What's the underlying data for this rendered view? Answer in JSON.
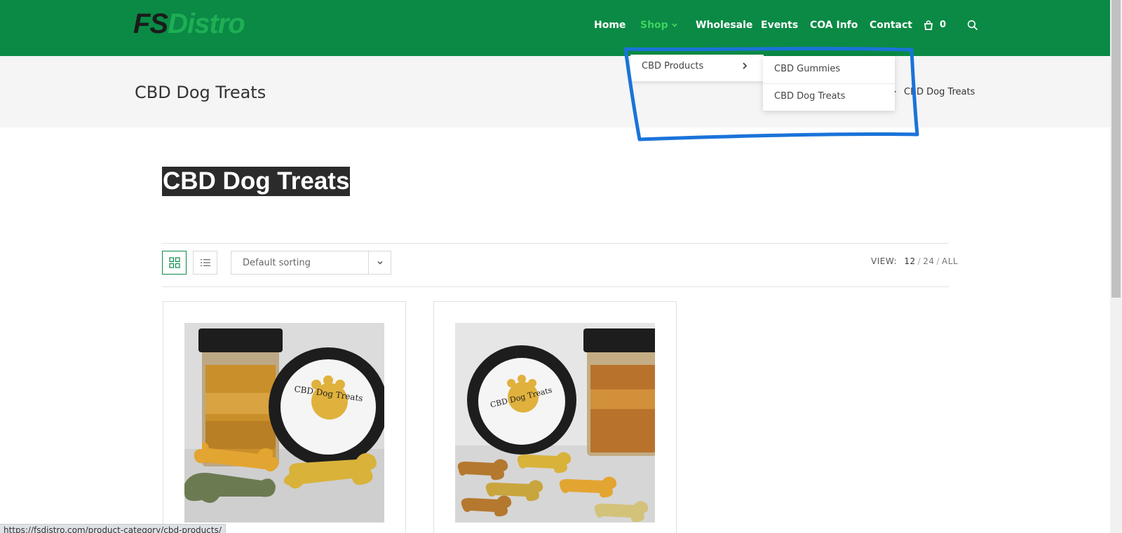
{
  "header": {
    "logo_fs": "FS",
    "logo_distro": "Distro",
    "nav": [
      "Home",
      "Shop",
      "Wholesale",
      "Events",
      "COA Info",
      "Contact"
    ],
    "active_nav": "Shop",
    "cart_count": "0",
    "colors": {
      "bar": "#0a8a45",
      "active": "#3ed35f"
    }
  },
  "dropdown": {
    "item": "CBD Products",
    "submenu": [
      "CBD Gummies",
      "CBD Dog Treats"
    ]
  },
  "titlebar": {
    "heading": "CBD Dog Treats",
    "breadcrumb_current": "CBD Dog Treats",
    "breadcrumb_sep": ">"
  },
  "main": {
    "heading": "CBD Dog Treats"
  },
  "toolbar": {
    "sort_label": "Default sorting",
    "view_label": "VIEW:",
    "view_options": [
      "12",
      "24",
      "ALL"
    ]
  },
  "products": {
    "jar_label_1": "CBD Dog Treats",
    "jar_label_2": "CBD Dog Treats"
  },
  "statusbar": {
    "url": "https://fsdistro.com/product-category/cbd-products/"
  },
  "annotation_color": "#1a73d9"
}
